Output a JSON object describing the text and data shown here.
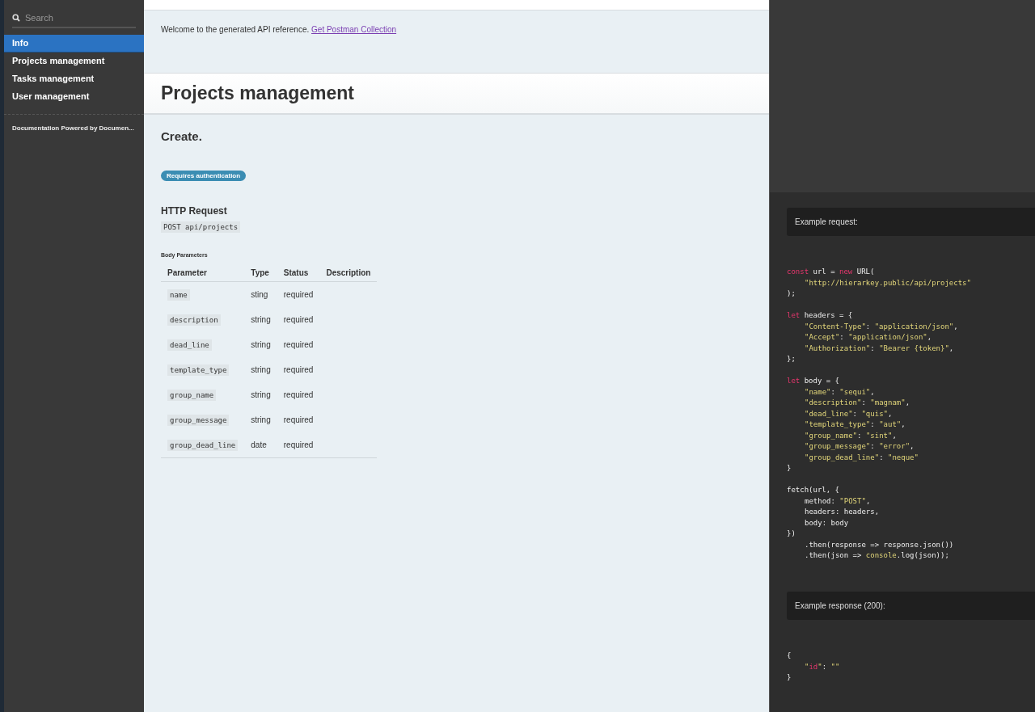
{
  "sidebar": {
    "search": {
      "placeholder": "Search"
    },
    "items": [
      {
        "label": "Info",
        "selected": true
      },
      {
        "label": "Projects management",
        "selected": false
      },
      {
        "label": "Tasks management",
        "selected": false
      },
      {
        "label": "User management",
        "selected": false
      }
    ],
    "footer": "Documentation Powered by Documen..."
  },
  "intro": {
    "text": "Welcome to the generated API reference.",
    "link": "Get Postman Collection"
  },
  "section_title": "Projects management",
  "endpoint": {
    "title": "Create.",
    "badge": "Requires authentication",
    "request_heading": "HTTP Request",
    "request": "POST api/projects",
    "params_heading": "Body Parameters",
    "columns": [
      "Parameter",
      "Type",
      "Status",
      "Description"
    ],
    "rows": [
      {
        "name": "name",
        "type": "sting",
        "status": "required"
      },
      {
        "name": "description",
        "type": "string",
        "status": "required"
      },
      {
        "name": "dead_line",
        "type": "string",
        "status": "required"
      },
      {
        "name": "template_type",
        "type": "string",
        "status": "required"
      },
      {
        "name": "group_name",
        "type": "string",
        "status": "required"
      },
      {
        "name": "group_message",
        "type": "string",
        "status": "required"
      },
      {
        "name": "group_dead_line",
        "type": "date",
        "status": "required"
      }
    ]
  },
  "example_request": {
    "label": "Example request:",
    "blocks": [
      [
        {
          "indented": false,
          "tokens": [
            {
              "kind": "kw",
              "text": "const"
            },
            {
              "kind": "plain",
              "text": " url = "
            },
            {
              "kind": "kw",
              "text": "new"
            },
            {
              "kind": "plain",
              "text": " URL("
            }
          ]
        },
        {
          "indented": true,
          "tokens": [
            {
              "kind": "str",
              "text": "\"http://hierarkey.public/api/projects\""
            }
          ]
        },
        {
          "indented": false,
          "tokens": [
            {
              "kind": "plain",
              "text": ");"
            }
          ]
        }
      ],
      [
        {
          "indented": false,
          "tokens": [
            {
              "kind": "kw",
              "text": "let"
            },
            {
              "kind": "plain",
              "text": " headers = {"
            }
          ]
        },
        {
          "indented": true,
          "tokens": [
            {
              "kind": "str",
              "text": "\"Content-Type\""
            },
            {
              "kind": "plain",
              "text": ": "
            },
            {
              "kind": "str",
              "text": "\"application/json\""
            },
            {
              "kind": "plain",
              "text": ","
            }
          ]
        },
        {
          "indented": true,
          "tokens": [
            {
              "kind": "str",
              "text": "\"Accept\""
            },
            {
              "kind": "plain",
              "text": ": "
            },
            {
              "kind": "str",
              "text": "\"application/json\""
            },
            {
              "kind": "plain",
              "text": ","
            }
          ]
        },
        {
          "indented": true,
          "tokens": [
            {
              "kind": "str",
              "text": "\"Authorization\""
            },
            {
              "kind": "plain",
              "text": ": "
            },
            {
              "kind": "str",
              "text": "\"Bearer {token}\""
            },
            {
              "kind": "plain",
              "text": ","
            }
          ]
        },
        {
          "indented": false,
          "tokens": [
            {
              "kind": "plain",
              "text": "};"
            }
          ]
        }
      ],
      [
        {
          "indented": false,
          "tokens": [
            {
              "kind": "kw",
              "text": "let"
            },
            {
              "kind": "plain",
              "text": " body = {"
            }
          ]
        },
        {
          "indented": true,
          "tokens": [
            {
              "kind": "str",
              "text": "\"name\""
            },
            {
              "kind": "plain",
              "text": ": "
            },
            {
              "kind": "str",
              "text": "\"sequi\""
            },
            {
              "kind": "plain",
              "text": ","
            }
          ]
        },
        {
          "indented": true,
          "tokens": [
            {
              "kind": "str",
              "text": "\"description\""
            },
            {
              "kind": "plain",
              "text": ": "
            },
            {
              "kind": "str",
              "text": "\"magnam\""
            },
            {
              "kind": "plain",
              "text": ","
            }
          ]
        },
        {
          "indented": true,
          "tokens": [
            {
              "kind": "str",
              "text": "\"dead_line\""
            },
            {
              "kind": "plain",
              "text": ": "
            },
            {
              "kind": "str",
              "text": "\"quis\""
            },
            {
              "kind": "plain",
              "text": ","
            }
          ]
        },
        {
          "indented": true,
          "tokens": [
            {
              "kind": "str",
              "text": "\"template_type\""
            },
            {
              "kind": "plain",
              "text": ": "
            },
            {
              "kind": "str",
              "text": "\"aut\""
            },
            {
              "kind": "plain",
              "text": ","
            }
          ]
        },
        {
          "indented": true,
          "tokens": [
            {
              "kind": "str",
              "text": "\"group_name\""
            },
            {
              "kind": "plain",
              "text": ": "
            },
            {
              "kind": "str",
              "text": "\"sint\""
            },
            {
              "kind": "plain",
              "text": ","
            }
          ]
        },
        {
          "indented": true,
          "tokens": [
            {
              "kind": "str",
              "text": "\"group_message\""
            },
            {
              "kind": "plain",
              "text": ": "
            },
            {
              "kind": "str",
              "text": "\"error\""
            },
            {
              "kind": "plain",
              "text": ","
            }
          ]
        },
        {
          "indented": true,
          "tokens": [
            {
              "kind": "str",
              "text": "\"group_dead_line\""
            },
            {
              "kind": "plain",
              "text": ": "
            },
            {
              "kind": "str",
              "text": "\"neque\""
            }
          ]
        },
        {
          "indented": false,
          "tokens": [
            {
              "kind": "plain",
              "text": "}"
            }
          ]
        }
      ],
      [
        {
          "indented": false,
          "tokens": [
            {
              "kind": "plain",
              "text": "fetch(url, {"
            }
          ]
        },
        {
          "indented": true,
          "tokens": [
            {
              "kind": "plain",
              "text": "method: "
            },
            {
              "kind": "str",
              "text": "\"POST\""
            },
            {
              "kind": "plain",
              "text": ","
            }
          ]
        },
        {
          "indented": true,
          "tokens": [
            {
              "kind": "plain",
              "text": "headers: headers,"
            }
          ]
        },
        {
          "indented": true,
          "tokens": [
            {
              "kind": "plain",
              "text": "body: body"
            }
          ]
        },
        {
          "indented": false,
          "tokens": [
            {
              "kind": "plain",
              "text": "})"
            }
          ]
        },
        {
          "indented": true,
          "tokens": [
            {
              "kind": "plain",
              "text": ".then(response => response.json())"
            }
          ]
        },
        {
          "indented": true,
          "tokens": [
            {
              "kind": "plain",
              "text": ".then(json => "
            },
            {
              "kind": "str",
              "text": "console"
            },
            {
              "kind": "plain",
              "text": ".log(json));"
            }
          ]
        }
      ]
    ]
  },
  "example_response": {
    "label": "Example response (200):",
    "blocks": [
      [
        {
          "indented": false,
          "tokens": [
            {
              "kind": "plain",
              "text": "{"
            }
          ]
        },
        {
          "indented": true,
          "tokens": [
            {
              "kind": "str",
              "text": "\""
            },
            {
              "kind": "kw",
              "text": "id"
            },
            {
              "kind": "str",
              "text": "\""
            },
            {
              "kind": "plain",
              "text": ": "
            },
            {
              "kind": "str",
              "text": "\"\""
            }
          ]
        },
        {
          "indented": false,
          "tokens": [
            {
              "kind": "plain",
              "text": "}"
            }
          ]
        }
      ]
    ]
  }
}
